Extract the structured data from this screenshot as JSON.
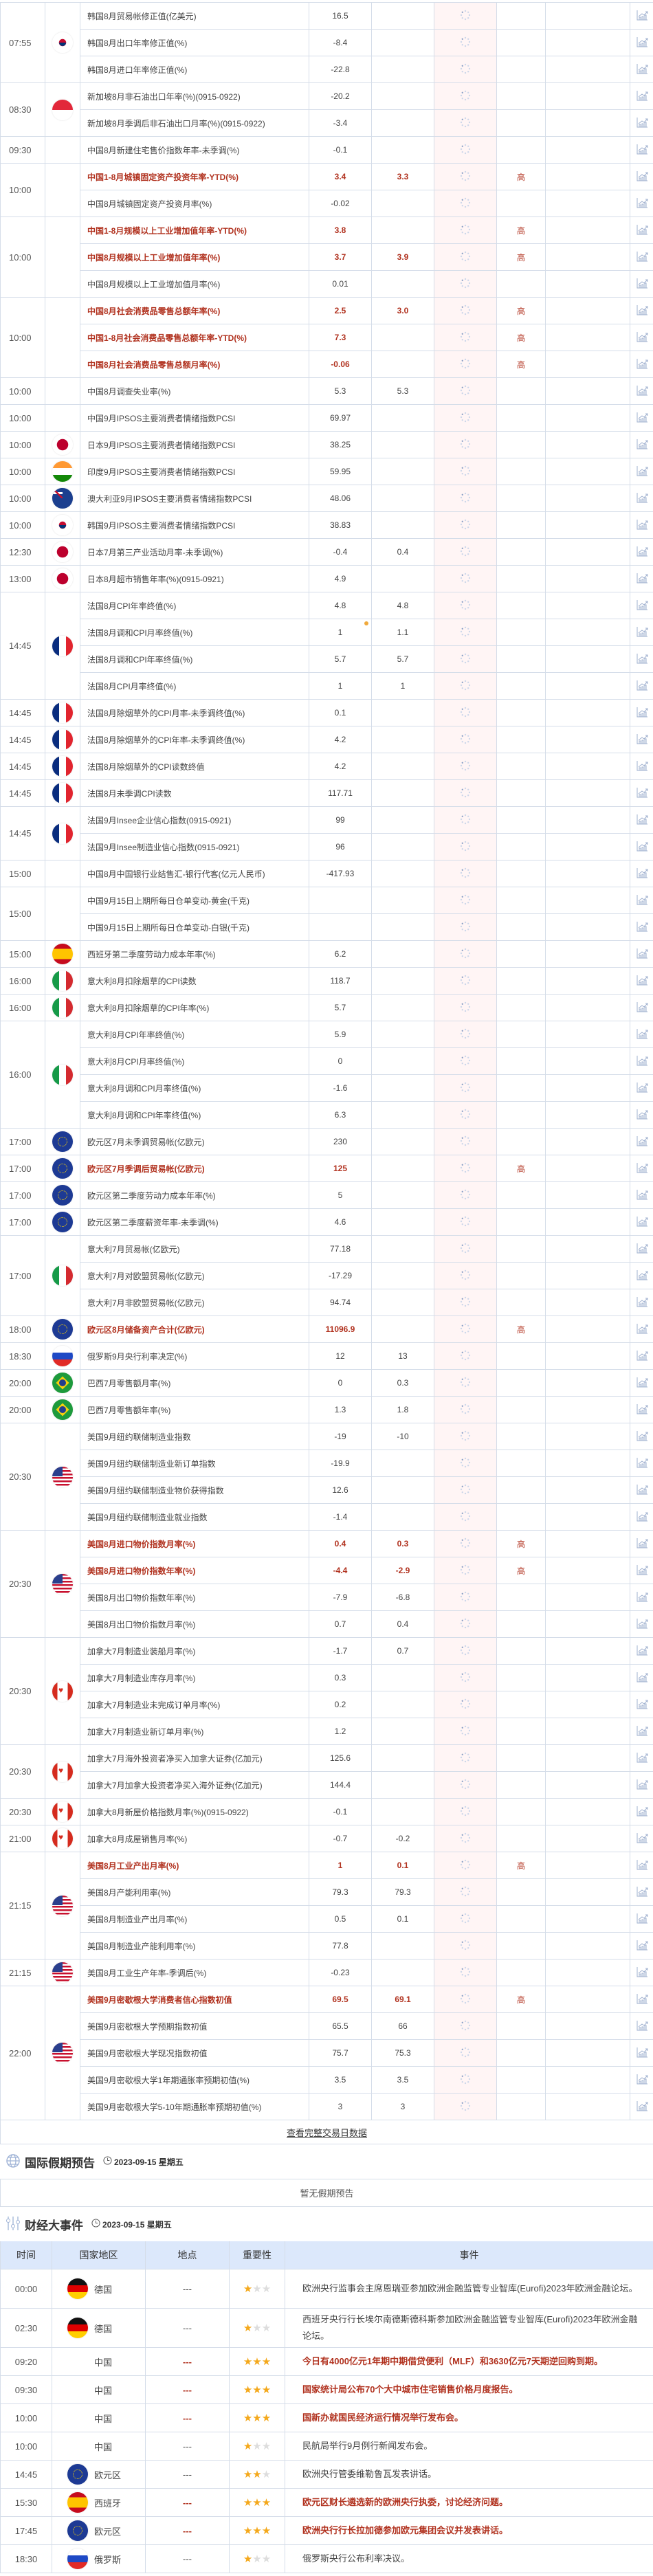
{
  "calendar": {
    "groups": [
      {
        "time": "07:55",
        "flag": "flag-kr",
        "rows": [
          {
            "name": "韩国8月贸易帐修正值(亿美元)",
            "prev": "16.5"
          },
          {
            "name": "韩国8月出口年率修正值(%)",
            "prev": "-8.4"
          },
          {
            "name": "韩国8月进口年率修正值(%)",
            "prev": "-22.8"
          }
        ]
      },
      {
        "time": "08:30",
        "flag": "flag-sg",
        "rows": [
          {
            "name": "新加坡8月非石油出口年率(%)(0915-0922)",
            "prev": "-20.2"
          },
          {
            "name": "新加坡8月季调后非石油出口月率(%)(0915-0922)",
            "prev": "-3.4"
          }
        ]
      },
      {
        "time": "09:30",
        "flag": "flag-none",
        "rows": [
          {
            "name": "中国8月新建住宅售价指数年率-未季调(%)",
            "prev": "-0.1"
          }
        ]
      },
      {
        "time": "10:00",
        "flag": "flag-none",
        "rows": [
          {
            "name": "中国1-8月城镇固定资产投资年率-YTD(%)",
            "prev": "3.4",
            "forecast": "3.3",
            "importance": "高"
          },
          {
            "name": "中国8月城镇固定资产投资月率(%)",
            "prev": "-0.02"
          }
        ]
      },
      {
        "time": "10:00",
        "flag": "flag-none",
        "rows": [
          {
            "name": "中国1-8月规模以上工业增加值年率-YTD(%)",
            "prev": "3.8",
            "importance": "高"
          },
          {
            "name": "中国8月规模以上工业增加值年率(%)",
            "prev": "3.7",
            "forecast": "3.9",
            "importance": "高"
          },
          {
            "name": "中国8月规模以上工业增加值月率(%)",
            "prev": "0.01"
          }
        ]
      },
      {
        "time": "10:00",
        "flag": "flag-none",
        "rows": [
          {
            "name": "中国8月社会消费品零售总额年率(%)",
            "prev": "2.5",
            "forecast": "3.0",
            "importance": "高"
          },
          {
            "name": "中国1-8月社会消费品零售总额年率-YTD(%)",
            "prev": "7.3",
            "importance": "高"
          },
          {
            "name": "中国8月社会消费品零售总额月率(%)",
            "prev": "-0.06",
            "importance": "高"
          }
        ]
      },
      {
        "time": "10:00",
        "flag": "flag-none",
        "rows": [
          {
            "name": "中国8月调查失业率(%)",
            "prev": "5.3",
            "forecast": "5.3"
          }
        ]
      },
      {
        "time": "10:00",
        "flag": "flag-none",
        "rows": [
          {
            "name": "中国9月IPSOS主要消费者情绪指数PCSI",
            "prev": "69.97"
          }
        ]
      },
      {
        "time": "10:00",
        "flag": "flag-jp",
        "rows": [
          {
            "name": "日本9月IPSOS主要消费者情绪指数PCSI",
            "prev": "38.25"
          }
        ]
      },
      {
        "time": "10:00",
        "flag": "flag-in",
        "rows": [
          {
            "name": "印度9月IPSOS主要消费者情绪指数PCSI",
            "prev": "59.95"
          }
        ]
      },
      {
        "time": "10:00",
        "flag": "flag-au",
        "rows": [
          {
            "name": "澳大利亚9月IPSOS主要消费者情绪指数PCSI",
            "prev": "48.06"
          }
        ]
      },
      {
        "time": "10:00",
        "flag": "flag-kr",
        "rows": [
          {
            "name": "韩国9月IPSOS主要消费者情绪指数PCSI",
            "prev": "38.83"
          }
        ]
      },
      {
        "time": "12:30",
        "flag": "flag-jp",
        "rows": [
          {
            "name": "日本7月第三产业活动月率-未季调(%)",
            "prev": "-0.4",
            "forecast": "0.4"
          }
        ]
      },
      {
        "time": "13:00",
        "flag": "flag-jp",
        "rows": [
          {
            "name": "日本8月超市销售年率(%)(0915-0921)",
            "prev": "4.9"
          }
        ]
      },
      {
        "time": "14:45",
        "flag": "flag-fr",
        "rows": [
          {
            "name": "法国8月CPI年率终值(%)",
            "prev": "4.8",
            "forecast": "4.8"
          },
          {
            "name": "法国8月调和CPI月率终值(%)",
            "prev": "1",
            "forecast": "1.1",
            "revised": true
          },
          {
            "name": "法国8月调和CPI年率终值(%)",
            "prev": "5.7",
            "forecast": "5.7"
          },
          {
            "name": "法国8月CPI月率终值(%)",
            "prev": "1",
            "forecast": "1"
          }
        ]
      },
      {
        "time": "14:45",
        "flag": "flag-fr",
        "rows": [
          {
            "name": "法国8月除烟草外的CPI月率-未季调终值(%)",
            "prev": "0.1"
          }
        ]
      },
      {
        "time": "14:45",
        "flag": "flag-fr",
        "rows": [
          {
            "name": "法国8月除烟草外的CPI年率-未季调终值(%)",
            "prev": "4.2"
          }
        ]
      },
      {
        "time": "14:45",
        "flag": "flag-fr",
        "rows": [
          {
            "name": "法国8月除烟草外的CPI读数终值",
            "prev": "4.2"
          }
        ]
      },
      {
        "time": "14:45",
        "flag": "flag-fr",
        "rows": [
          {
            "name": "法国8月未季调CPI读数",
            "prev": "117.71"
          }
        ]
      },
      {
        "time": "14:45",
        "flag": "flag-fr",
        "rows": [
          {
            "name": "法国9月Insee企业信心指数(0915-0921)",
            "prev": "99"
          },
          {
            "name": "法国9月Insee制造业信心指数(0915-0921)",
            "prev": "96"
          }
        ]
      },
      {
        "time": "15:00",
        "flag": "flag-none",
        "rows": [
          {
            "name": "中国8月中国银行业结售汇-银行代客(亿元人民币)",
            "prev": "-417.93"
          }
        ]
      },
      {
        "time": "15:00",
        "flag": "flag-none",
        "rows": [
          {
            "name": "中国9月15日上期所每日仓单变动-黄金(千克)"
          },
          {
            "name": "中国9月15日上期所每日仓单变动-白银(千克)"
          }
        ]
      },
      {
        "time": "15:00",
        "flag": "flag-es",
        "rows": [
          {
            "name": "西班牙第二季度劳动力成本年率(%)",
            "prev": "6.2"
          }
        ]
      },
      {
        "time": "16:00",
        "flag": "flag-it",
        "rows": [
          {
            "name": "意大利8月扣除烟草的CPI读数",
            "prev": "118.7"
          }
        ]
      },
      {
        "time": "16:00",
        "flag": "flag-it",
        "rows": [
          {
            "name": "意大利8月扣除烟草的CPI年率(%)",
            "prev": "5.7"
          }
        ]
      },
      {
        "time": "16:00",
        "flag": "flag-it",
        "rows": [
          {
            "name": "意大利8月CPI年率终值(%)",
            "prev": "5.9"
          },
          {
            "name": "意大利8月CPI月率终值(%)",
            "prev": "0"
          },
          {
            "name": "意大利8月调和CPI月率终值(%)",
            "prev": "-1.6"
          },
          {
            "name": "意大利8月调和CPI年率终值(%)",
            "prev": "6.3"
          }
        ]
      },
      {
        "time": "17:00",
        "flag": "flag-eu",
        "rows": [
          {
            "name": "欧元区7月未季调贸易帐(亿欧元)",
            "prev": "230"
          }
        ]
      },
      {
        "time": "17:00",
        "flag": "flag-eu",
        "rows": [
          {
            "name": "欧元区7月季调后贸易帐(亿欧元)",
            "prev": "125",
            "importance": "高"
          }
        ]
      },
      {
        "time": "17:00",
        "flag": "flag-eu",
        "rows": [
          {
            "name": "欧元区第二季度劳动力成本年率(%)",
            "prev": "5"
          }
        ]
      },
      {
        "time": "17:00",
        "flag": "flag-eu",
        "rows": [
          {
            "name": "欧元区第二季度薪资年率-未季调(%)",
            "prev": "4.6"
          }
        ]
      },
      {
        "time": "17:00",
        "flag": "flag-it",
        "rows": [
          {
            "name": "意大利7月贸易帐(亿欧元)",
            "prev": "77.18"
          },
          {
            "name": "意大利7月对欧盟贸易帐(亿欧元)",
            "prev": "-17.29"
          },
          {
            "name": "意大利7月非欧盟贸易帐(亿欧元)",
            "prev": "94.74"
          }
        ]
      },
      {
        "time": "18:00",
        "flag": "flag-eu",
        "rows": [
          {
            "name": "欧元区8月储备资产合计(亿欧元)",
            "prev": "11096.9",
            "importance": "高"
          }
        ]
      },
      {
        "time": "18:30",
        "flag": "flag-ru",
        "rows": [
          {
            "name": "俄罗斯9月央行利率决定(%)",
            "prev": "12",
            "forecast": "13"
          }
        ]
      },
      {
        "time": "20:00",
        "flag": "flag-br",
        "rows": [
          {
            "name": "巴西7月零售额月率(%)",
            "prev": "0",
            "forecast": "0.3"
          }
        ]
      },
      {
        "time": "20:00",
        "flag": "flag-br",
        "rows": [
          {
            "name": "巴西7月零售额年率(%)",
            "prev": "1.3",
            "forecast": "1.8"
          }
        ]
      },
      {
        "time": "20:30",
        "flag": "flag-us",
        "rows": [
          {
            "name": "美国9月纽约联储制造业指数",
            "prev": "-19",
            "forecast": "-10"
          },
          {
            "name": "美国9月纽约联储制造业新订单指数",
            "prev": "-19.9"
          },
          {
            "name": "美国9月纽约联储制造业物价获得指数",
            "prev": "12.6"
          },
          {
            "name": "美国9月纽约联储制造业就业指数",
            "prev": "-1.4"
          }
        ]
      },
      {
        "time": "20:30",
        "flag": "flag-us",
        "rows": [
          {
            "name": "美国8月进口物价指数月率(%)",
            "prev": "0.4",
            "forecast": "0.3",
            "importance": "高"
          },
          {
            "name": "美国8月进口物价指数年率(%)",
            "prev": "-4.4",
            "forecast": "-2.9",
            "importance": "高"
          },
          {
            "name": "美国8月出口物价指数年率(%)",
            "prev": "-7.9",
            "forecast": "-6.8"
          },
          {
            "name": "美国8月出口物价指数月率(%)",
            "prev": "0.7",
            "forecast": "0.4"
          }
        ]
      },
      {
        "time": "20:30",
        "flag": "flag-ca",
        "rows": [
          {
            "name": "加拿大7月制造业装船月率(%)",
            "prev": "-1.7",
            "forecast": "0.7"
          },
          {
            "name": "加拿大7月制造业库存月率(%)",
            "prev": "0.3"
          },
          {
            "name": "加拿大7月制造业未完成订单月率(%)",
            "prev": "0.2"
          },
          {
            "name": "加拿大7月制造业新订单月率(%)",
            "prev": "1.2"
          }
        ]
      },
      {
        "time": "20:30",
        "flag": "flag-ca",
        "rows": [
          {
            "name": "加拿大7月海外投资者净买入加拿大证券(亿加元)",
            "prev": "125.6"
          },
          {
            "name": "加拿大7月加拿大投资者净买入海外证券(亿加元)",
            "prev": "144.4"
          }
        ]
      },
      {
        "time": "20:30",
        "flag": "flag-ca",
        "rows": [
          {
            "name": "加拿大8月新屋价格指数月率(%)(0915-0922)",
            "prev": "-0.1"
          }
        ]
      },
      {
        "time": "21:00",
        "flag": "flag-ca",
        "rows": [
          {
            "name": "加拿大8月成屋销售月率(%)",
            "prev": "-0.7",
            "forecast": "-0.2"
          }
        ]
      },
      {
        "time": "21:15",
        "flag": "flag-us",
        "rows": [
          {
            "name": "美国8月工业产出月率(%)",
            "prev": "1",
            "forecast": "0.1",
            "importance": "高"
          },
          {
            "name": "美国8月产能利用率(%)",
            "prev": "79.3",
            "forecast": "79.3"
          },
          {
            "name": "美国8月制造业产出月率(%)",
            "prev": "0.5",
            "forecast": "0.1"
          },
          {
            "name": "美国8月制造业产能利用率(%)",
            "prev": "77.8"
          }
        ]
      },
      {
        "time": "21:15",
        "flag": "flag-us",
        "rows": [
          {
            "name": "美国8月工业生产年率-季调后(%)",
            "prev": "-0.23"
          }
        ]
      },
      {
        "time": "22:00",
        "flag": "flag-us",
        "rows": [
          {
            "name": "美国9月密歇根大学消费者信心指数初值",
            "prev": "69.5",
            "forecast": "69.1",
            "importance": "高"
          },
          {
            "name": "美国9月密歇根大学预期指数初值",
            "prev": "65.5",
            "forecast": "66"
          },
          {
            "name": "美国9月密歇根大学现况指数初值",
            "prev": "75.7",
            "forecast": "75.3"
          },
          {
            "name": "美国9月密歇根大学1年期通胀率预期初值(%)",
            "prev": "3.5",
            "forecast": "3.5"
          },
          {
            "name": "美国9月密歇根大学5-10年期通胀率预期初值(%)",
            "prev": "3",
            "forecast": "3"
          }
        ]
      }
    ],
    "more_link": "查看完整交易日数据"
  },
  "holidays": {
    "title": "国际假期预告",
    "date": "2023-09-15 星期五",
    "empty": "暂无假期预告"
  },
  "events": {
    "title": "财经大事件",
    "date": "2023-09-15 星期五",
    "headers": [
      "时间",
      "国家地区",
      "地点",
      "重要性",
      "事件"
    ],
    "rows": [
      {
        "time": "00:00",
        "country": "德国",
        "flag": "flag-de",
        "place": "---",
        "stars": 1,
        "text": "欧洲央行监事会主席恩瑞亚参加欧洲金融监管专业智库(Eurofi)2023年欧洲金融论坛。"
      },
      {
        "time": "02:30",
        "country": "德国",
        "flag": "flag-de",
        "place": "---",
        "stars": 1,
        "text": "西班牙央行行长埃尔南德斯德科斯参加欧洲金融监管专业智库(Eurofi)2023年欧洲金融论坛。"
      },
      {
        "time": "09:20",
        "country": "中国",
        "flag": "flag-none",
        "place": "---",
        "stars": 3,
        "text": "今日有4000亿元1年期中期借贷便利（MLF）和3630亿元7天期逆回购到期。"
      },
      {
        "time": "09:30",
        "country": "中国",
        "flag": "flag-none",
        "place": "---",
        "stars": 3,
        "text": "国家统计局公布70个大中城市住宅销售价格月度报告。"
      },
      {
        "time": "10:00",
        "country": "中国",
        "flag": "flag-none",
        "place": "---",
        "stars": 3,
        "text": "国新办就国民经济运行情况举行发布会。"
      },
      {
        "time": "10:00",
        "country": "中国",
        "flag": "flag-none",
        "place": "---",
        "stars": 1,
        "text": "民航局举行9月例行新闻发布会。"
      },
      {
        "time": "14:45",
        "country": "欧元区",
        "flag": "flag-eu",
        "place": "---",
        "stars": 2,
        "text": "欧洲央行管委维勒鲁瓦发表讲话。"
      },
      {
        "time": "15:30",
        "country": "西班牙",
        "flag": "flag-es",
        "place": "---",
        "stars": 3,
        "text": "欧元区财长遴选新的欧洲央行执委，讨论经济问题。"
      },
      {
        "time": "17:45",
        "country": "欧元区",
        "flag": "flag-eu",
        "place": "---",
        "stars": 3,
        "text": "欧洲央行行长拉加德参加欧元集团会议并发表讲话。"
      },
      {
        "time": "18:30",
        "country": "俄罗斯",
        "flag": "flag-ru",
        "place": "---",
        "stars": 1,
        "text": "俄罗斯央行公布利率决议。"
      }
    ]
  },
  "colors": {
    "high": "#b1321f",
    "actual_bg": "#fff5f5",
    "header_bg": "#dce8fb",
    "star": "#f4a81b"
  }
}
